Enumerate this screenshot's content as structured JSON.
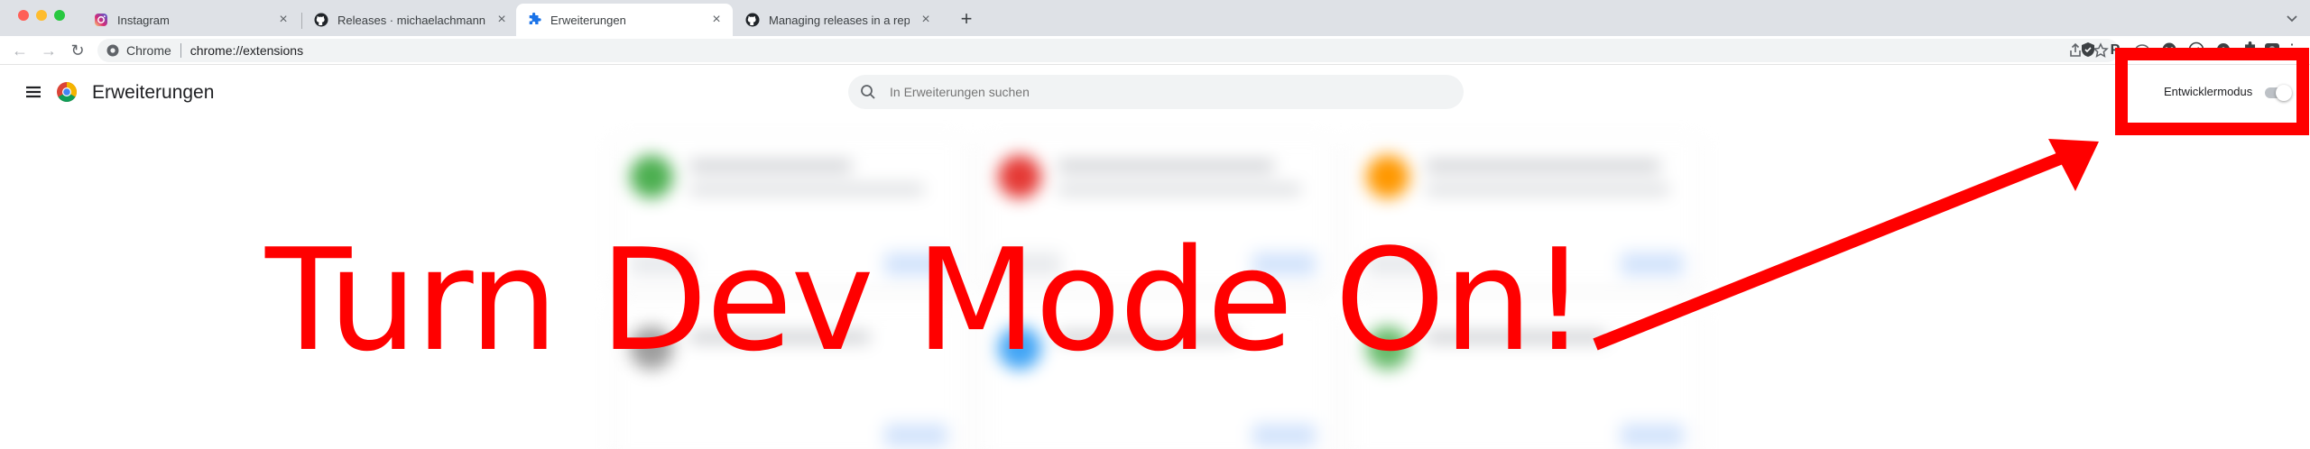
{
  "browser": {
    "tabs": [
      {
        "label": "Instagram",
        "favicon": "instagram-icon",
        "active": false
      },
      {
        "label": "Releases · michaelachmann/in",
        "favicon": "github-icon",
        "active": false
      },
      {
        "label": "Erweiterungen",
        "favicon": "puzzle-icon",
        "active": true
      },
      {
        "label": "Managing releases in a reposit",
        "favicon": "github-icon",
        "active": false
      }
    ],
    "new_tab": "+",
    "address": {
      "site_label": "Chrome",
      "url": "chrome://extensions"
    }
  },
  "extensions_page": {
    "title": "Erweiterungen",
    "search_placeholder": "In Erweiterungen suchen",
    "dev_mode_label": "Entwicklermodus",
    "dev_mode_on": false
  },
  "annotation": {
    "text": "Turn Dev Mode On!",
    "color": "#ff0000"
  },
  "colors": {
    "tabstrip": "#dee1e6",
    "accent_blue": "#1a73e8",
    "annotation_red": "#ff0000"
  }
}
